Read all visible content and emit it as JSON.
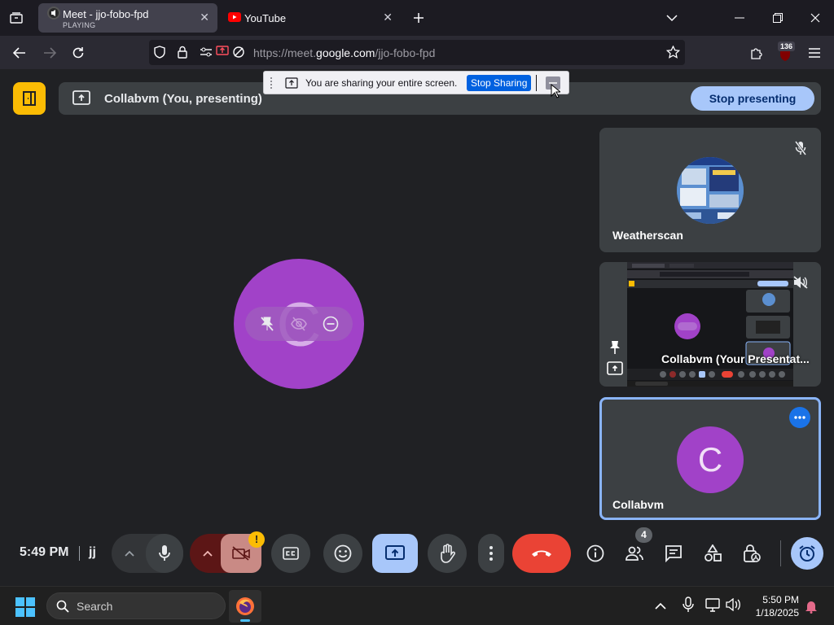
{
  "browser": {
    "tabs": [
      {
        "title": "Meet - jjo-fobo-fpd",
        "subtitle": "PLAYING"
      },
      {
        "title": "YouTube"
      }
    ],
    "url_prefix": "https://meet.",
    "url_domain": "google.com",
    "url_path": "/jjo-fobo-fpd",
    "extension_badge": "136"
  },
  "share_banner": {
    "message": "You are sharing your entire screen.",
    "stop_label": "Stop Sharing"
  },
  "presenting_bar": {
    "title": "Collabvm (You, presenting)",
    "stop_label": "Stop presenting"
  },
  "main": {
    "avatar_letter": "C",
    "avatar_color": "#a142c8"
  },
  "tiles": [
    {
      "name": "Weatherscan"
    },
    {
      "name": "Collabvm (Your Presentat..."
    },
    {
      "name": "Collabvm",
      "avatar_letter": "C"
    }
  ],
  "controls": {
    "time": "5:49 PM",
    "meeting_code": "jj",
    "people_count": "4",
    "warning_badge": "!"
  },
  "taskbar": {
    "search_label": "Search",
    "time": "5:50 PM",
    "date": "1/18/2025"
  },
  "colors": {
    "accent": "#a8c7fa",
    "end_call": "#ea4335",
    "meet_logo": "#fbbc04",
    "tile_highlight": "#8ab4f8"
  }
}
